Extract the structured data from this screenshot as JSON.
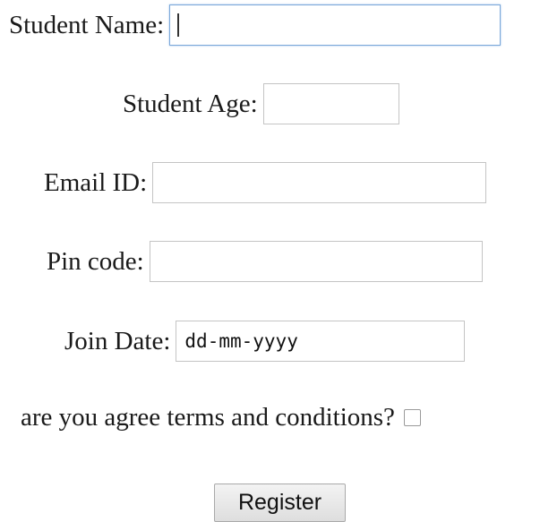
{
  "form": {
    "student_name": {
      "label": "Student Name:",
      "value": ""
    },
    "student_age": {
      "label": "Student Age:",
      "value": ""
    },
    "email_id": {
      "label": "Email ID:",
      "value": ""
    },
    "pin_code": {
      "label": "Pin code:",
      "value": ""
    },
    "join_date": {
      "label": "Join Date:",
      "placeholder": "dd-mm-yyyy"
    },
    "terms": {
      "label": "are you agree terms and conditions?",
      "checked": false
    },
    "register_label": "Register"
  },
  "colors": {
    "focus_border": "#7aa7d9",
    "input_border": "#c4c4c4"
  }
}
